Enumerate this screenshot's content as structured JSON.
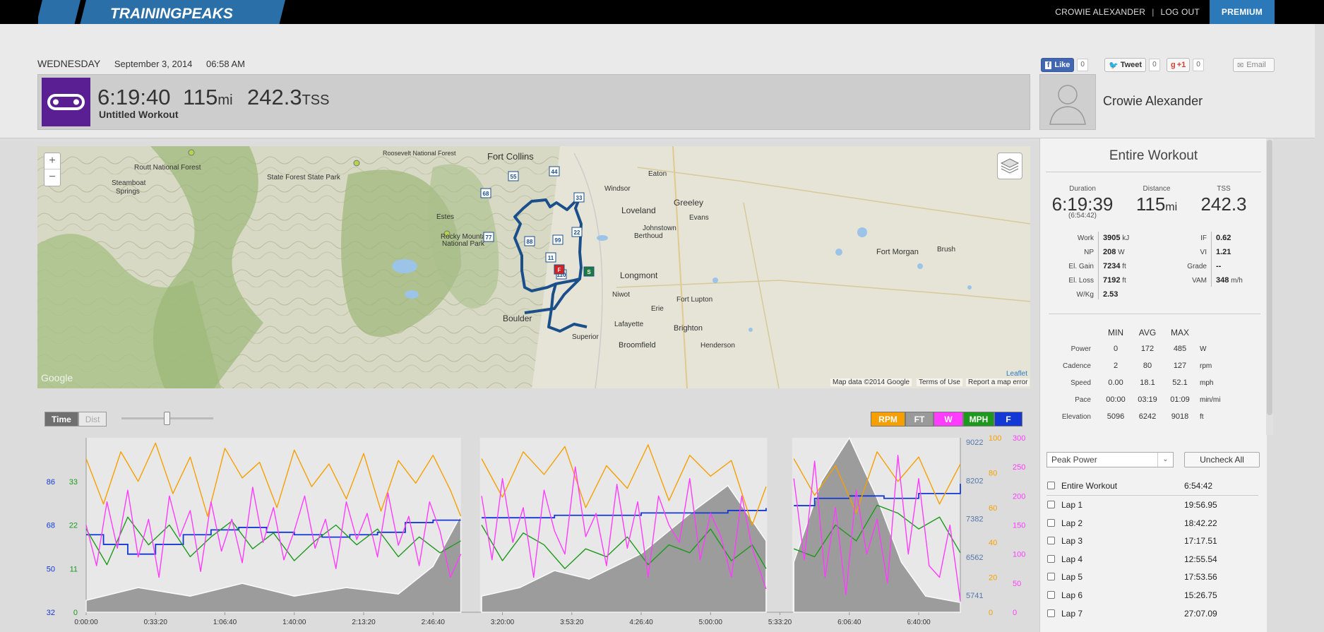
{
  "brand": {
    "logo": "TRAININGPEAKS"
  },
  "topnav": {
    "user": "CROWIE ALEXANDER",
    "sep": "|",
    "logout": "LOG OUT",
    "premium": "PREMIUM"
  },
  "social": {
    "like": "Like",
    "like_count": "0",
    "tweet": "Tweet",
    "tweet_count": "0",
    "gplus": "+1",
    "gplus_count": "0",
    "email": "Email"
  },
  "workout": {
    "day": "WEDNESDAY",
    "date": "September 3, 2014",
    "time": "06:58 AM",
    "duration": "6:19:40",
    "distance": "115",
    "distance_unit": "mi",
    "tss": "242.3",
    "tss_unit": "TSS",
    "name": "Untitled Workout",
    "icon": "bike-chain-icon"
  },
  "athlete": {
    "name": "Crowie Alexander"
  },
  "map": {
    "places": [
      "Fort Collins",
      "Routt National Forest",
      "Roosevelt National Forest",
      "State Forest State Park",
      "Steamboat",
      "Springs",
      "Eaton",
      "Windsor",
      "Greeley",
      "Loveland",
      "Evans",
      "Johnstown",
      "Berthoud",
      "Estes",
      "Rocky Mountain",
      "National Park",
      "Fort Morgan",
      "Brush",
      "Longmont",
      "Niwot",
      "Fort Lupton",
      "Erie",
      "Boulder",
      "Lafayette",
      "Brighton",
      "Superior",
      "Broomfield",
      "Henderson"
    ],
    "markers": [
      "44",
      "55",
      "68",
      "33",
      "22",
      "77",
      "88",
      "99",
      "11",
      "110",
      "S",
      "F"
    ],
    "attrib": [
      "Map data ©2014 Google",
      "Terms of Use",
      "Report a map error"
    ],
    "leaflet": "Leaflet",
    "google": "Google",
    "zoom_in": "+",
    "zoom_out": "−"
  },
  "panel": {
    "title": "Entire Workout",
    "summary": [
      {
        "label": "Duration",
        "value": "6:19:39",
        "sub": "(6:54:42)"
      },
      {
        "label": "Distance",
        "value": "115",
        "unit": "mi"
      },
      {
        "label": "TSS",
        "value": "242.3"
      }
    ],
    "metrics_left": [
      {
        "label": "Work",
        "value": "3905",
        "unit": "kJ"
      },
      {
        "label": "NP",
        "value": "208",
        "unit": "W"
      },
      {
        "label": "El. Gain",
        "value": "7234",
        "unit": "ft"
      },
      {
        "label": "El. Loss",
        "value": "7192",
        "unit": "ft"
      },
      {
        "label": "W/Kg",
        "value": "2.53",
        "unit": ""
      }
    ],
    "metrics_right": [
      {
        "label": "IF",
        "value": "0.62",
        "unit": ""
      },
      {
        "label": "VI",
        "value": "1.21",
        "unit": ""
      },
      {
        "label": "Grade",
        "value": "--",
        "unit": ""
      },
      {
        "label": "VAM",
        "value": "348",
        "unit": "m/h"
      }
    ],
    "table": {
      "headers": [
        "MIN",
        "AVG",
        "MAX"
      ],
      "rows": [
        [
          "Power",
          "0",
          "172",
          "485",
          "W"
        ],
        [
          "Cadence",
          "2",
          "80",
          "127",
          "rpm"
        ],
        [
          "Speed",
          "0.00",
          "18.1",
          "52.1",
          "mph"
        ],
        [
          "Pace",
          "00:00",
          "03:19",
          "01:09",
          "min/mi"
        ],
        [
          "Elevation",
          "5096",
          "6242",
          "9018",
          "ft"
        ]
      ]
    }
  },
  "laps_panel": {
    "dropdown": "Peak Power",
    "uncheck": "Uncheck All",
    "rows": [
      {
        "name": "Entire Workout",
        "time": "6:54:42"
      },
      {
        "name": "Lap 1",
        "time": "19:56.95"
      },
      {
        "name": "Lap 2",
        "time": "18:42.22"
      },
      {
        "name": "Lap 3",
        "time": "17:17.51"
      },
      {
        "name": "Lap 4",
        "time": "12:55.54"
      },
      {
        "name": "Lap 5",
        "time": "17:53.56"
      },
      {
        "name": "Lap 6",
        "time": "15:26.75"
      },
      {
        "name": "Lap 7",
        "time": "27:07.09"
      }
    ]
  },
  "chart_controls": {
    "time": "Time",
    "dist": "Dist",
    "slider": 0.5,
    "legend": [
      {
        "label": "RPM",
        "color": "#f5a000"
      },
      {
        "label": "FT",
        "color": "#9a9a9a"
      },
      {
        "label": "W",
        "color": "#ff3cff"
      },
      {
        "label": "MPH",
        "color": "#1d9a1d"
      },
      {
        "label": "F",
        "color": "#1338d6"
      }
    ]
  },
  "chart_data": {
    "type": "line",
    "x_ticks": [
      "0:00:00",
      "0:33:20",
      "1:06:40",
      "1:40:00",
      "2:13:20",
      "2:46:40",
      "3:20:00",
      "3:53:20",
      "4:26:40",
      "5:00:00",
      "5:33:20",
      "6:06:40",
      "6:40:00"
    ],
    "x_range": [
      0,
      25200
    ],
    "axes": {
      "speed": {
        "ticks": [
          "86",
          "68",
          "50",
          "32"
        ],
        "color": "#1338d6",
        "range": [
          32,
          104
        ]
      },
      "hr": {
        "ticks": [
          "33",
          "22",
          "11",
          "0"
        ],
        "color": "#1d9a1d",
        "range": [
          0,
          44
        ]
      },
      "elevation": {
        "ticks": [
          "9022",
          "8202",
          "7382",
          "6562",
          "5741"
        ],
        "color": "#5577aa",
        "range": [
          4921,
          9022
        ]
      },
      "cadence": {
        "ticks": [
          "100",
          "80",
          "60",
          "40",
          "20",
          "0"
        ],
        "color": "#f5a000",
        "range": [
          0,
          100
        ]
      },
      "power": {
        "ticks": [
          "300",
          "250",
          "200",
          "150",
          "100",
          "50",
          "0"
        ],
        "color": "#ff3cff",
        "range": [
          0,
          300
        ]
      }
    },
    "gaps": [
      [
        10800,
        11350
      ],
      [
        19630,
        20350
      ]
    ],
    "series": [
      {
        "key": "elevation",
        "color": "#9a9a9a",
        "x": [
          0,
          1500,
          3000,
          4500,
          6000,
          7500,
          9000,
          10000,
          10800,
          11400,
          12500,
          13500,
          14500,
          16000,
          17500,
          18500,
          19600,
          20400,
          21200,
          22000,
          22800,
          23500,
          24200,
          25200
        ],
        "y": [
          5200,
          5500,
          5300,
          5600,
          5300,
          5500,
          5350,
          6000,
          7200,
          5300,
          5500,
          5900,
          5700,
          6300,
          7300,
          7900,
          6600,
          6100,
          8000,
          9022,
          7600,
          6100,
          5300,
          5150
        ]
      },
      {
        "key": "speed",
        "color": "#1338d6",
        "x": [
          0,
          500,
          1200,
          2000,
          2800,
          3600,
          4400,
          5200,
          6000,
          6800,
          7600,
          8400,
          9200,
          10000,
          10800,
          11400,
          12500,
          13500,
          14500,
          16000,
          17500,
          18500,
          19600,
          20400,
          21000,
          22000,
          23000,
          24000,
          25200
        ],
        "y": [
          64,
          60,
          56,
          60,
          64,
          66,
          67,
          65,
          64,
          63,
          64,
          65,
          69,
          70,
          70,
          71,
          71,
          72,
          72,
          73,
          73,
          74,
          75,
          76,
          79,
          80,
          79,
          81,
          85
        ]
      },
      {
        "key": "hr",
        "color": "#1d9a1d",
        "x": [
          0,
          600,
          1200,
          1800,
          2400,
          3000,
          3600,
          4200,
          4800,
          5400,
          6000,
          6600,
          7200,
          7800,
          8400,
          9000,
          9600,
          10200,
          10800,
          11400,
          12000,
          12600,
          13200,
          13800,
          14400,
          15000,
          15600,
          16200,
          16800,
          17400,
          18000,
          18600,
          19200,
          19600,
          20400,
          21000,
          21600,
          22200,
          22800,
          23400,
          24000,
          24600,
          25200
        ],
        "y": [
          21,
          12,
          24,
          17,
          22,
          14,
          19,
          23,
          16,
          20,
          13,
          18,
          22,
          17,
          21,
          14,
          19,
          15,
          18,
          22,
          13,
          20,
          17,
          11,
          16,
          14,
          19,
          12,
          17,
          15,
          21,
          13,
          17,
          11,
          16,
          14,
          22,
          18,
          27,
          25,
          21,
          24,
          15
        ]
      },
      {
        "key": "cadence",
        "color": "#f5a000",
        "x": [
          0,
          500,
          1000,
          1500,
          2000,
          2500,
          3000,
          3500,
          4000,
          4500,
          5000,
          5500,
          6000,
          6500,
          7000,
          7500,
          8000,
          8500,
          9000,
          9500,
          10000,
          10500,
          10800,
          11400,
          12000,
          12600,
          13200,
          13800,
          14400,
          15000,
          15600,
          16200,
          16800,
          17400,
          18000,
          18600,
          19200,
          19600,
          20400,
          21000,
          21600,
          22200,
          22800,
          23400,
          24000,
          24600,
          25200
        ],
        "y": [
          88,
          62,
          92,
          75,
          97,
          68,
          89,
          55,
          94,
          77,
          86,
          60,
          93,
          72,
          85,
          65,
          91,
          58,
          87,
          74,
          90,
          70,
          55,
          88,
          66,
          92,
          79,
          95,
          60,
          84,
          71,
          96,
          64,
          90,
          78,
          87,
          50,
          72,
          88,
          67,
          84,
          57,
          92,
          75,
          89,
          62,
          85
        ]
      },
      {
        "key": "power",
        "color": "#ff3cff",
        "x": [
          0,
          300,
          600,
          900,
          1200,
          1500,
          1800,
          2100,
          2400,
          2700,
          3000,
          3300,
          3600,
          3900,
          4200,
          4500,
          4800,
          5100,
          5400,
          5700,
          6000,
          6300,
          6600,
          6900,
          7200,
          7500,
          7800,
          8100,
          8400,
          8700,
          9000,
          9300,
          9600,
          9900,
          10200,
          10500,
          10800,
          11400,
          11700,
          12000,
          12300,
          12600,
          12900,
          13200,
          13500,
          13800,
          14100,
          14400,
          14700,
          15000,
          15300,
          15600,
          15900,
          16200,
          16500,
          16800,
          17100,
          17400,
          17700,
          18000,
          18300,
          18600,
          18900,
          19200,
          19600,
          20400,
          20700,
          21000,
          21300,
          21600,
          21900,
          22200,
          22500,
          22800,
          23100,
          23400,
          23700,
          24000,
          24300,
          24600,
          24900,
          25200
        ],
        "y": [
          150,
          80,
          190,
          110,
          210,
          95,
          160,
          60,
          200,
          130,
          175,
          70,
          190,
          105,
          160,
          85,
          215,
          120,
          180,
          90,
          140,
          200,
          110,
          160,
          75,
          190,
          125,
          170,
          95,
          205,
          115,
          165,
          80,
          190,
          140,
          60,
          100,
          200,
          90,
          230,
          120,
          180,
          60,
          210,
          140,
          100,
          250,
          130,
          170,
          80,
          220,
          110,
          190,
          60,
          200,
          150,
          120,
          230,
          90,
          170,
          130,
          60,
          200,
          110,
          40,
          230,
          90,
          260,
          60,
          180,
          30,
          210,
          100,
          160,
          50,
          270,
          100,
          230,
          80,
          60,
          150,
          20
        ]
      }
    ]
  }
}
